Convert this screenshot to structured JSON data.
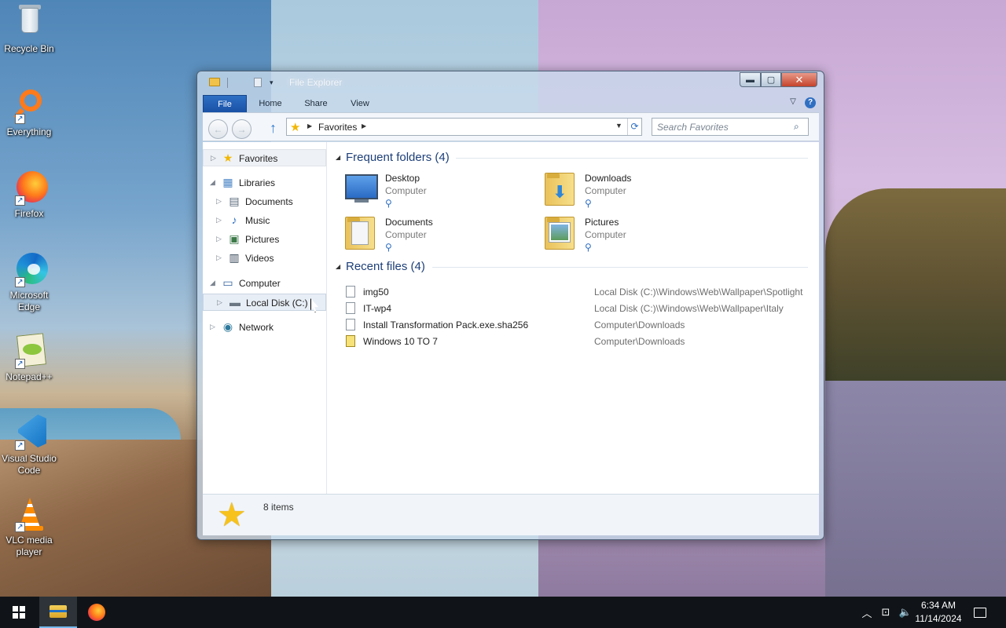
{
  "desktop": {
    "icons": [
      {
        "label": "Recycle Bin",
        "icon": "recycle-bin-icon"
      },
      {
        "label": "Everything",
        "icon": "everything-icon"
      },
      {
        "label": "Firefox",
        "icon": "firefox-icon"
      },
      {
        "label": "Microsoft Edge",
        "icon": "edge-icon"
      },
      {
        "label": "Notepad++",
        "icon": "notepad-plus-plus-icon"
      },
      {
        "label": "Visual Studio Code",
        "icon": "vscode-icon"
      },
      {
        "label": "VLC media player",
        "icon": "vlc-icon"
      }
    ]
  },
  "window": {
    "title": "File Explorer",
    "controls": {
      "minimize": "▬",
      "maximize": "▢",
      "close": "✕"
    }
  },
  "ribbon": {
    "tabs": [
      "File",
      "Home",
      "Share",
      "View"
    ],
    "help_glyph": "?",
    "collapse_glyph": "▽"
  },
  "nav": {
    "back_glyph": "←",
    "forward_glyph": "→",
    "up_glyph": "↑",
    "address": {
      "segment": "Favorites",
      "caret": "▶",
      "dropdown": "▼",
      "refresh": "⟳"
    },
    "search": {
      "placeholder": "Search Favorites",
      "glyph": "⌕"
    }
  },
  "navpane": {
    "items": [
      {
        "label": "Favorites",
        "arrow": "▷",
        "icon": "★"
      },
      {
        "label": "Libraries",
        "arrow": "◢",
        "icon": "▦"
      },
      {
        "label": "Documents",
        "arrow": "▷",
        "icon": "▤"
      },
      {
        "label": "Music",
        "arrow": "▷",
        "icon": "♪"
      },
      {
        "label": "Pictures",
        "arrow": "▷",
        "icon": "▣"
      },
      {
        "label": "Videos",
        "arrow": "▷",
        "icon": "▥"
      },
      {
        "label": "Computer",
        "arrow": "◢",
        "icon": "▭"
      },
      {
        "label": "Local Disk (C:)",
        "arrow": "▷",
        "icon": "▬"
      },
      {
        "label": "Network",
        "arrow": "▷",
        "icon": "◉"
      }
    ]
  },
  "main": {
    "frequent": {
      "title": "Frequent folders (4)",
      "folders": [
        {
          "name": "Desktop",
          "location": "Computer"
        },
        {
          "name": "Downloads",
          "location": "Computer"
        },
        {
          "name": "Documents",
          "location": "Computer"
        },
        {
          "name": "Pictures",
          "location": "Computer"
        }
      ],
      "pin_glyph": "⚲"
    },
    "recent": {
      "title": "Recent files (4)",
      "files": [
        {
          "name": "img50",
          "path": "Local Disk (C:)\\Windows\\Web\\Wallpaper\\Spotlight"
        },
        {
          "name": "IT-wp4",
          "path": "Local Disk (C:)\\Windows\\Web\\Wallpaper\\Italy"
        },
        {
          "name": "Install Transformation Pack.exe.sha256",
          "path": "Computer\\Downloads"
        },
        {
          "name": "Windows 10 TO 7",
          "path": "Computer\\Downloads"
        }
      ]
    },
    "section_triangle": "◢"
  },
  "details": {
    "count_text": "8 items",
    "star_glyph": "★"
  },
  "taskbar": {
    "tray_up_glyph": "︿",
    "network_glyph": "⊡",
    "volume_glyph": "🔈",
    "time": "6:34 AM",
    "date": "11/14/2024"
  }
}
